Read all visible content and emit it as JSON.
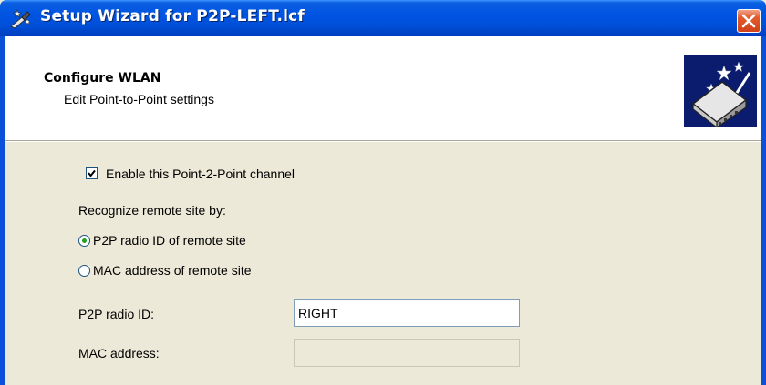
{
  "window": {
    "title": "Setup Wizard for P2P-LEFT.lcf",
    "app_icon": "wizard-wand-icon",
    "close_icon": "close-icon"
  },
  "header": {
    "title": "Configure WLAN",
    "subtitle": "Edit Point-to-Point settings",
    "graphic_icon": "wizard-router-icon"
  },
  "content": {
    "enable_checkbox": {
      "label": "Enable this Point-2-Point channel",
      "checked": true
    },
    "recognize_label": "Recognize remote site by:",
    "radio_options": [
      {
        "label": "P2P radio ID of remote site",
        "selected": true
      },
      {
        "label": "MAC address of remote site",
        "selected": false
      }
    ],
    "fields": {
      "p2p_radio_id": {
        "label": "P2P radio ID:",
        "value": "RIGHT",
        "enabled": true
      },
      "mac_address": {
        "label": "MAC address:",
        "value": "",
        "enabled": false
      }
    }
  },
  "colors": {
    "titlebar": "#0054e3",
    "dialog_bg": "#ece9d8",
    "close_button": "#e35b2c",
    "radio_dot": "#21a121"
  }
}
